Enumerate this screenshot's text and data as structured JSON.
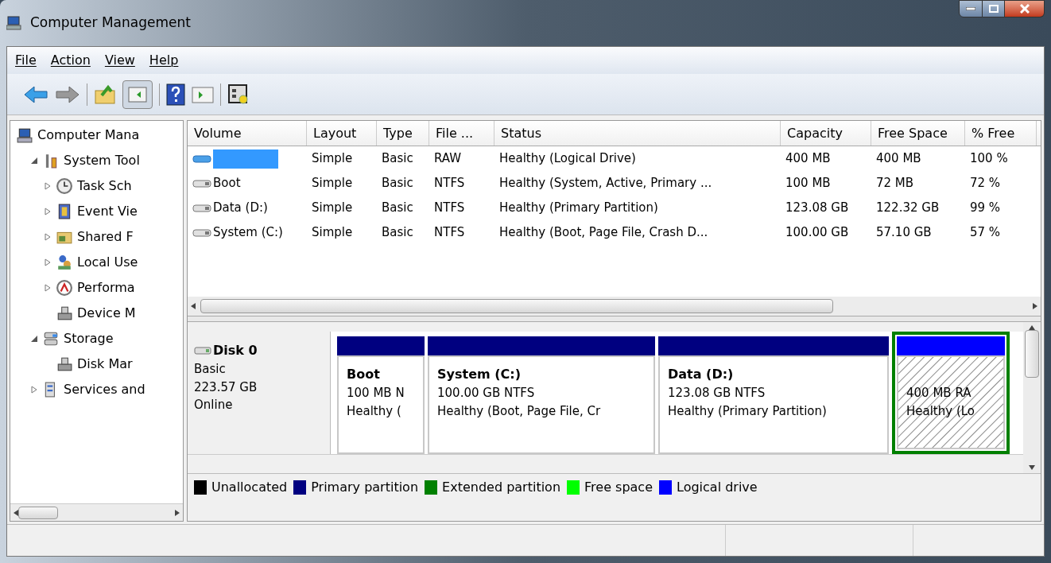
{
  "window": {
    "title": "Computer Management"
  },
  "menu": [
    "File",
    "Action",
    "View",
    "Help"
  ],
  "tree": [
    {
      "label": "Computer Mana",
      "children": [
        {
          "label": "System Tool",
          "expanded": true,
          "children": [
            {
              "label": "Task Sch",
              "expanded": false
            },
            {
              "label": "Event Vie",
              "expanded": false
            },
            {
              "label": "Shared F",
              "expanded": false
            },
            {
              "label": "Local Use",
              "expanded": false
            },
            {
              "label": "Performa",
              "expanded": false
            },
            {
              "label": "Device M"
            }
          ]
        },
        {
          "label": "Storage",
          "expanded": true,
          "children": [
            {
              "label": "Disk Mar"
            }
          ]
        },
        {
          "label": "Services and",
          "expanded": false
        }
      ]
    }
  ],
  "table": {
    "columns": [
      "Volume",
      "Layout",
      "Type",
      "File ...",
      "Status",
      "Capacity",
      "Free Space",
      "% Free"
    ],
    "rows": [
      {
        "redacted": true,
        "cells": [
          "",
          "Simple",
          "Basic",
          "RAW",
          "Healthy (Logical Drive)",
          "400 MB",
          "400 MB",
          "100 %"
        ]
      },
      {
        "redacted": false,
        "cells": [
          "Boot",
          "Simple",
          "Basic",
          "NTFS",
          "Healthy (System, Active, Primary ...",
          "100 MB",
          "72 MB",
          "72 %"
        ]
      },
      {
        "redacted": false,
        "cells": [
          "Data (D:)",
          "Simple",
          "Basic",
          "NTFS",
          "Healthy (Primary Partition)",
          "123.08 GB",
          "122.32 GB",
          "99 %"
        ]
      },
      {
        "redacted": false,
        "cells": [
          "System (C:)",
          "Simple",
          "Basic",
          "NTFS",
          "Healthy (Boot, Page File, Crash D...",
          "100.00 GB",
          "57.10 GB",
          "57 %"
        ]
      }
    ]
  },
  "disk": {
    "name": "Disk 0",
    "type": "Basic",
    "size": "223.57 GB",
    "state": "Online",
    "partitions": [
      {
        "kind": "primary",
        "selected": false,
        "name": "Boot",
        "size": "100 MB N",
        "status": "Healthy ("
      },
      {
        "kind": "primary",
        "selected": false,
        "name": "System  (C:)",
        "size": "100.00 GB NTFS",
        "status": "Healthy (Boot, Page File, Cr"
      },
      {
        "kind": "primary",
        "selected": false,
        "name": "Data  (D:)",
        "size": "123.08 GB NTFS",
        "status": "Healthy (Primary Partition)"
      },
      {
        "kind": "logical",
        "selected": true,
        "size": "400 MB RA",
        "status": "Healthy (Lo"
      }
    ]
  },
  "legend": [
    {
      "label": "Unallocated",
      "color": "#000000"
    },
    {
      "label": "Primary partition",
      "color": "#000080"
    },
    {
      "label": "Extended partition",
      "color": "#008000"
    },
    {
      "label": "Free space",
      "color": "#00ff00"
    },
    {
      "label": "Logical drive",
      "color": "#0000ff"
    }
  ]
}
